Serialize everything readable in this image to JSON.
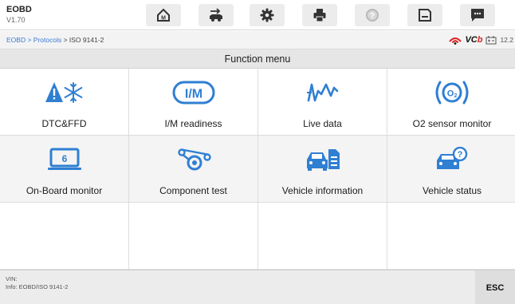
{
  "header": {
    "app_name": "EOBD",
    "version": "V1.70",
    "toolbar": [
      {
        "name": "home-button",
        "icon": "home-icon"
      },
      {
        "name": "vehicle-swap-button",
        "icon": "vehicle-swap-icon"
      },
      {
        "name": "settings-button",
        "icon": "gear-icon"
      },
      {
        "name": "print-button",
        "icon": "printer-icon"
      },
      {
        "name": "help-button",
        "icon": "help-icon"
      },
      {
        "name": "save-button",
        "icon": "save-icon"
      },
      {
        "name": "messages-button",
        "icon": "message-icon"
      }
    ]
  },
  "breadcrumb": {
    "item1": "EOBD",
    "sep1": " > ",
    "item2": "Protocols",
    "sep2": " > ",
    "current": "ISO 9141-2"
  },
  "status": {
    "vci_label": "VC",
    "vci_suffix": "b",
    "battery_voltage": "12.2"
  },
  "menu_title": "Function menu",
  "functions": [
    {
      "label": "DTC&FFD",
      "icon": "warning-snowflake-icon"
    },
    {
      "label": "I/M readiness",
      "icon": "im-readiness-icon"
    },
    {
      "label": "Live data",
      "icon": "live-data-icon"
    },
    {
      "label": "O2 sensor monitor",
      "icon": "o2-sensor-icon"
    },
    {
      "label": "On-Board monitor",
      "icon": "onboard-monitor-icon"
    },
    {
      "label": "Component test",
      "icon": "component-test-icon"
    },
    {
      "label": "Vehicle information",
      "icon": "vehicle-info-icon"
    },
    {
      "label": "Vehicle status",
      "icon": "vehicle-status-icon"
    }
  ],
  "footer": {
    "vin": "VIN:",
    "info": "Info: EOBD/ISO 9141-2",
    "esc_label": "ESC"
  },
  "colors": {
    "accent": "#2f7fd3",
    "link": "#3a7bd5",
    "vcb_red": "#e02020",
    "tile_alt": "#f4f4f4",
    "footer_bg": "#ececec"
  }
}
